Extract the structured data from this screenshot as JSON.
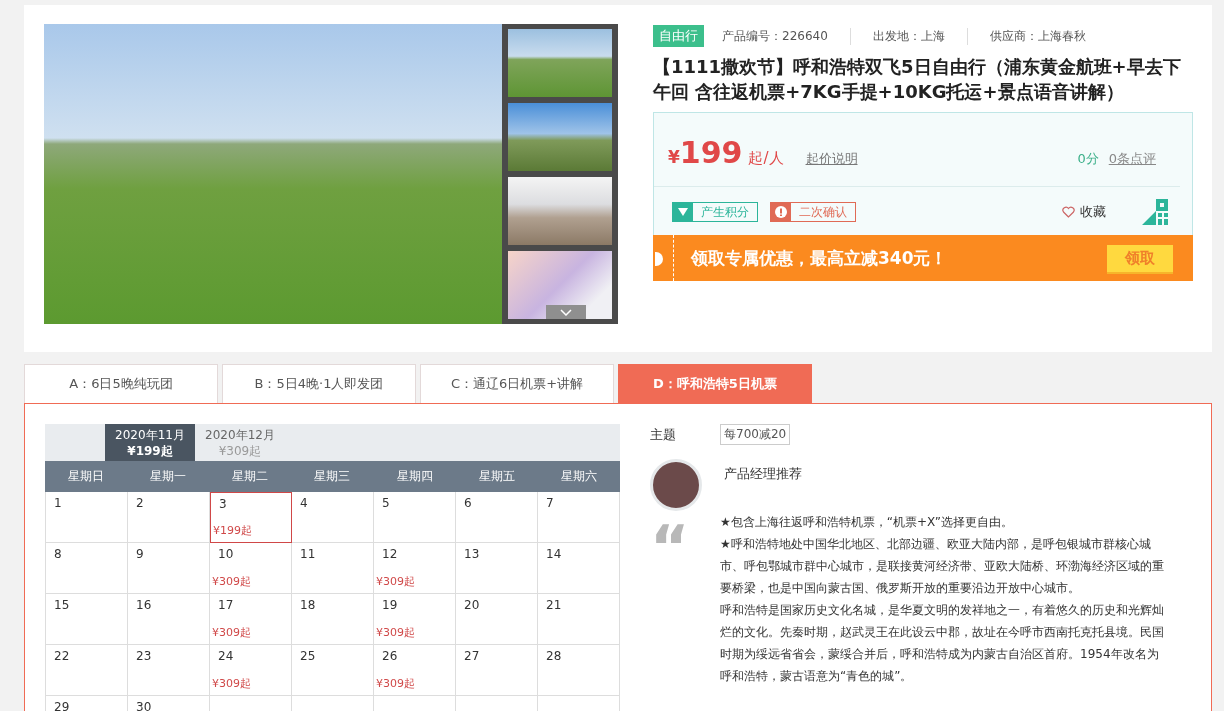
{
  "product": {
    "tag": "自由行",
    "code": "产品编号：226640",
    "departure": "出发地：上海",
    "supplier": "供应商：上海春秋",
    "title": "【1111撒欢节】呼和浩特双飞5日自由行（浦东黄金航班+早去下午回 含往返机票+7KG手提+10KG托运+景点语音讲解）",
    "currency": "¥",
    "price": "199",
    "price_unit": "起/人",
    "price_note": "起价说明",
    "score": "0分",
    "reviews": "0条点评",
    "badges": [
      {
        "kind": "points",
        "label": "产生积分"
      },
      {
        "kind": "confirm",
        "label": "二次确认"
      }
    ],
    "favorite": "收藏",
    "coupon": {
      "text": "领取专属优惠，最高立减340元！",
      "button": "领取"
    }
  },
  "tabs": [
    {
      "label": "A：6日5晚纯玩团",
      "selected": false
    },
    {
      "label": "B：5日4晚·1人即发团",
      "selected": false
    },
    {
      "label": "C：通辽6日机票+讲解",
      "selected": false
    },
    {
      "label": "D：呼和浩特5日机票",
      "selected": true
    }
  ],
  "calendar": {
    "months": [
      {
        "label": "2020年11月",
        "price": "¥199起",
        "selected": true
      },
      {
        "label": "2020年12月",
        "price": "¥309起",
        "selected": false
      }
    ],
    "weekdays": [
      "星期日",
      "星期一",
      "星期二",
      "星期三",
      "星期四",
      "星期五",
      "星期六"
    ],
    "weeks": [
      [
        {
          "day": "1"
        },
        {
          "day": "2"
        },
        {
          "day": "3",
          "price": "¥199起",
          "selected": true
        },
        {
          "day": "4"
        },
        {
          "day": "5"
        },
        {
          "day": "6"
        },
        {
          "day": "7"
        }
      ],
      [
        {
          "day": "8"
        },
        {
          "day": "9"
        },
        {
          "day": "10",
          "price": "¥309起"
        },
        {
          "day": "11"
        },
        {
          "day": "12",
          "price": "¥309起"
        },
        {
          "day": "13"
        },
        {
          "day": "14"
        }
      ],
      [
        {
          "day": "15"
        },
        {
          "day": "16"
        },
        {
          "day": "17",
          "price": "¥309起"
        },
        {
          "day": "18"
        },
        {
          "day": "19",
          "price": "¥309起"
        },
        {
          "day": "20"
        },
        {
          "day": "21"
        }
      ],
      [
        {
          "day": "22"
        },
        {
          "day": "23"
        },
        {
          "day": "24",
          "price": "¥309起"
        },
        {
          "day": "25"
        },
        {
          "day": "26",
          "price": "¥309起"
        },
        {
          "day": "27"
        },
        {
          "day": "28"
        }
      ],
      [
        {
          "day": "29"
        },
        {
          "day": "30"
        }
      ]
    ]
  },
  "info": {
    "theme_label": "主题",
    "theme_tag": "每700减20",
    "manager_title": "产品经理推荐",
    "quote_mark": "“",
    "paragraphs": [
      "★包含上海往返呼和浩特机票，“机票+X”选择更自由。",
      "★呼和浩特地处中国华北地区、北部边疆、欧亚大陆内部，是呼包银城市群核心城市、呼包鄂城市群中心城市，是联接黄河经济带、亚欧大陆桥、环渤海经济区域的重要桥梁，也是中国向蒙古国、俄罗斯开放的重要沿边开放中心城市。",
      "呼和浩特是国家历史文化名城，是华夏文明的发祥地之一，有着悠久的历史和光辉灿烂的文化。先秦时期，赵武灵王在此设云中郡，故址在今呼市西南托克托县境。民国时期为绥远省省会，蒙绥合并后，呼和浩特成为内蒙古自治区首府。1954年改名为呼和浩特，蒙古语意为“青色的城”。"
    ]
  }
}
